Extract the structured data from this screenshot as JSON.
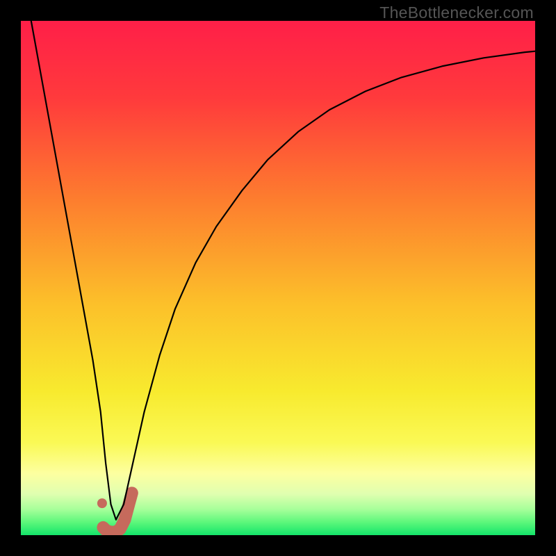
{
  "watermark": "TheBottleneсker.com",
  "chart_data": {
    "type": "line",
    "title": "",
    "xlabel": "",
    "ylabel": "",
    "xlim": [
      0,
      100
    ],
    "ylim": [
      0,
      100
    ],
    "gradient": {
      "stops": [
        {
          "offset": 0.0,
          "color": "#ff1f48"
        },
        {
          "offset": 0.15,
          "color": "#ff3a3c"
        },
        {
          "offset": 0.35,
          "color": "#fd7e2e"
        },
        {
          "offset": 0.55,
          "color": "#fcc02a"
        },
        {
          "offset": 0.72,
          "color": "#f8ea2e"
        },
        {
          "offset": 0.82,
          "color": "#faf955"
        },
        {
          "offset": 0.88,
          "color": "#fdffa0"
        },
        {
          "offset": 0.92,
          "color": "#e0ffb0"
        },
        {
          "offset": 0.95,
          "color": "#a6ff9a"
        },
        {
          "offset": 0.975,
          "color": "#5cf77b"
        },
        {
          "offset": 1.0,
          "color": "#14e46a"
        }
      ]
    },
    "series": [
      {
        "name": "bottleneck-curve",
        "color": "#000000",
        "width": 2.2,
        "x": [
          2,
          4,
          6,
          8,
          10,
          12,
          14,
          15.5,
          16.5,
          17.5,
          18.5,
          20,
          22,
          24,
          27,
          30,
          34,
          38,
          43,
          48,
          54,
          60,
          67,
          74,
          82,
          90,
          98,
          100
        ],
        "y": [
          100,
          89,
          78,
          67,
          56,
          45,
          34,
          24,
          14,
          6,
          3,
          6,
          15,
          24,
          35,
          44,
          53,
          60,
          67,
          73,
          78.5,
          82.7,
          86.3,
          89,
          91.2,
          92.8,
          93.9,
          94.1
        ]
      }
    ],
    "marker": {
      "name": "optimal-region",
      "color": "#c66a5c",
      "dot": {
        "x": 15.8,
        "y": 6.2,
        "r": 7
      },
      "hook": [
        {
          "x": 16.0,
          "y": 1.5
        },
        {
          "x": 16.6,
          "y": 0.9
        },
        {
          "x": 17.4,
          "y": 0.6
        },
        {
          "x": 18.4,
          "y": 0.6
        },
        {
          "x": 19.3,
          "y": 1.2
        },
        {
          "x": 20.2,
          "y": 3.0
        },
        {
          "x": 21.0,
          "y": 6.0
        },
        {
          "x": 21.6,
          "y": 8.2
        }
      ],
      "hook_width": 18
    }
  }
}
